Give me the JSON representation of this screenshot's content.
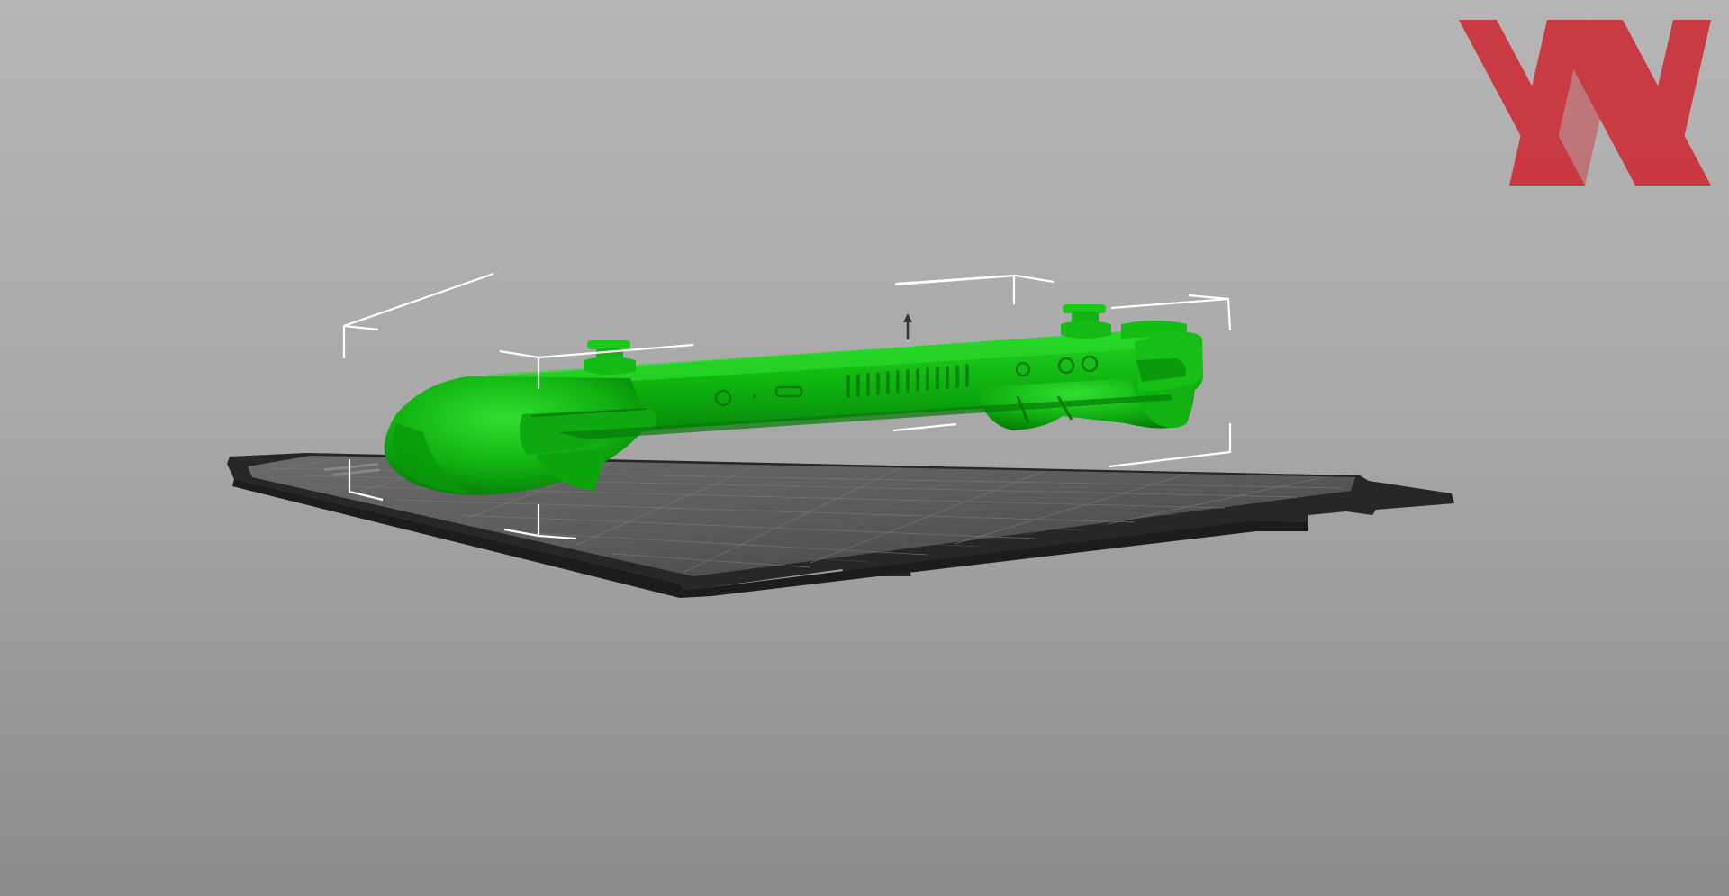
{
  "viewport": {
    "background_top": "#b5b5b5",
    "background_bottom": "#8b8b8b"
  },
  "build_plate": {
    "color": "#2a2b2a",
    "grid_color": "#6e6e6e"
  },
  "model": {
    "color": "#0fb40f",
    "highlight_color": "#22d022",
    "shadow_color": "#078a07"
  },
  "bounding_box": {
    "color": "#ffffff"
  },
  "move_gizmo": {
    "color": "#333333",
    "icon": "up-arrow-icon"
  },
  "watermark": {
    "color": "#d0202a",
    "icon": "xx-logo-icon"
  }
}
